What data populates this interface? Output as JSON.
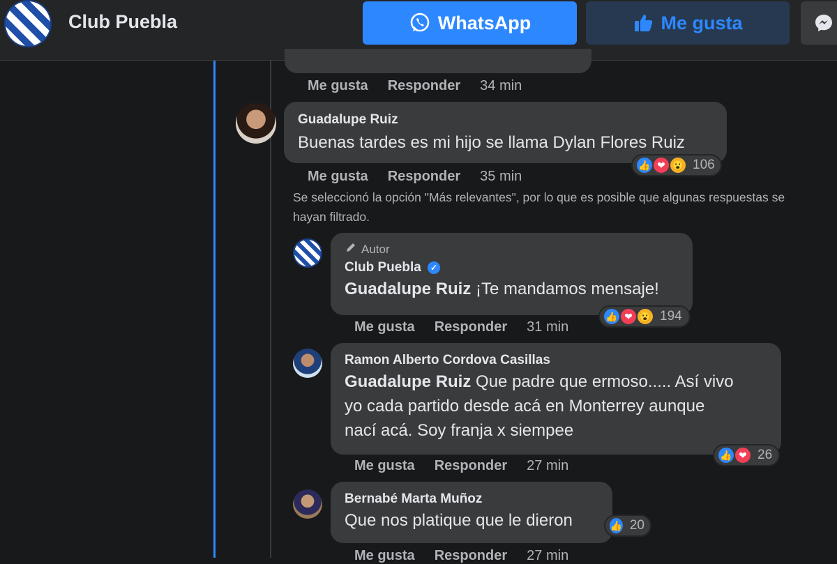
{
  "header": {
    "page_name": "Club Puebla",
    "whatsapp_label": "WhatsApp",
    "like_label": "Me gusta"
  },
  "colors": {
    "background": "#18191a",
    "surface": "#242526",
    "bubble": "#3a3b3c",
    "accent": "#2d88ff",
    "muted_text": "#b0b3b8"
  },
  "comments": [
    {
      "actions": {
        "like": "Me gusta",
        "reply": "Responder",
        "time": "34 min"
      }
    },
    {
      "author": "Guadalupe Ruiz",
      "text": "Buenas tardes es mi hijo se llama Dylan Flores Ruiz",
      "reactions": {
        "icons": [
          "like-icon",
          "love-icon",
          "wow-icon"
        ],
        "count": "106"
      },
      "actions": {
        "like": "Me gusta",
        "reply": "Responder",
        "time": "35 min"
      }
    }
  ],
  "filter_note": "Se seleccionó la opción \"Más relevantes\", por lo que es posible que algunas respuestas se hayan filtrado.",
  "replies": [
    {
      "badge": "Autor",
      "author": "Club Puebla",
      "mention": "Guadalupe Ruiz",
      "text": "¡Te mandamos mensaje!",
      "reactions": {
        "icons": [
          "like-icon",
          "love-icon",
          "wow-icon"
        ],
        "count": "194"
      },
      "actions": {
        "like": "Me gusta",
        "reply": "Responder",
        "time": "31 min"
      }
    },
    {
      "author": "Ramon Alberto Cordova Casillas",
      "mention": "Guadalupe Ruiz",
      "text_line1": "Que padre que ermoso..... Así vivo",
      "text_line2": "yo cada partido desde acá en Monterrey aunque",
      "text_line3": "nací acá. Soy franja x siempee",
      "reactions": {
        "icons": [
          "like-icon",
          "love-icon"
        ],
        "count": "26"
      },
      "actions": {
        "like": "Me gusta",
        "reply": "Responder",
        "time": "27 min"
      }
    },
    {
      "author": "Bernabé Marta Muñoz",
      "text": "Que nos platique que le dieron",
      "reactions": {
        "icons": [
          "like-icon"
        ],
        "count": "20"
      },
      "actions": {
        "like": "Me gusta",
        "reply": "Responder",
        "time": "27 min"
      }
    }
  ]
}
